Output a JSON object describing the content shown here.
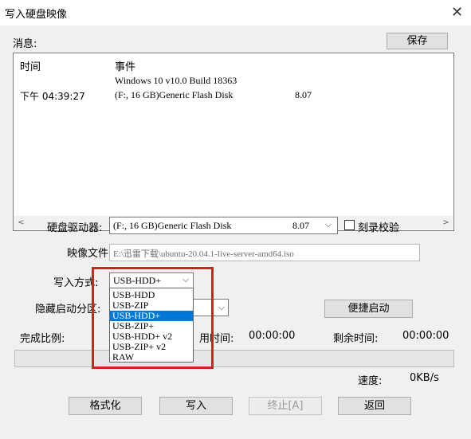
{
  "window": {
    "title": "写入硬盘映像",
    "close_glyph": "✕"
  },
  "messages": {
    "label": "消息:",
    "save_button": "保存",
    "col_time": "时间",
    "col_event": "事件",
    "rows": [
      {
        "time": "",
        "event": "Windows 10 v10.0 Build 18363",
        "extra": ""
      },
      {
        "time": "下午 04:39:27",
        "event": "(F:, 16 GB)Generic Flash Disk",
        "extra": "8.07"
      }
    ],
    "scroll_left": "<",
    "scroll_right": ">"
  },
  "form": {
    "drive_label": "硬盘驱动器:",
    "drive_value": "(F:, 16 GB)Generic Flash Disk",
    "drive_version": "8.07",
    "verify_label": "刻录校验",
    "image_label": "映像文件:",
    "image_value": "E:\\迅雷下载\\ubuntu-20.04.1-live-server-amd64.iso",
    "write_mode_label": "写入方式:",
    "write_mode_value": "USB-HDD+",
    "hidden_partition_label": "隐藏启动分区:",
    "quick_boot_button": "便捷启动",
    "write_mode_options": [
      "USB-HDD",
      "USB-ZIP",
      "USB-HDD+",
      "USB-ZIP+",
      "USB-HDD+ v2",
      "USB-ZIP+ v2",
      "RAW"
    ],
    "selected_option": "USB-HDD+"
  },
  "progress": {
    "complete_label": "完成比例:",
    "elapsed_label_visible": "用时间:",
    "elapsed_value": "00:00:00",
    "remaining_label": "剩余时间:",
    "remaining_value": "00:00:00",
    "speed_label": "速度:",
    "speed_value": "0KB/s",
    "fill_fraction": 0
  },
  "buttons": {
    "format": "格式化",
    "write": "写入",
    "abort": "终止[A]",
    "back": "返回"
  },
  "colors": {
    "accent": "#0078d7",
    "annotation_box": "#d42020",
    "dialog_bg": "#f0f0f0"
  }
}
